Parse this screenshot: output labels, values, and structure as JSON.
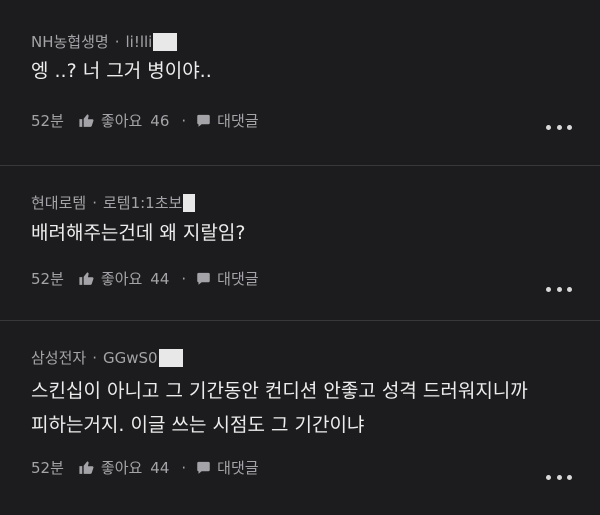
{
  "comments": [
    {
      "company": "NH농협생명",
      "username": "li!lli",
      "text": "엥 ..? 너 그거 병이야..",
      "time": "52분",
      "likes_label": "좋아요",
      "likes": "46",
      "reply_label": "대댓글"
    },
    {
      "company": "현대로템",
      "username": "로템1:1초보",
      "text": "배려해주는건데 왜 지랄임?",
      "time": "52분",
      "likes_label": "좋아요",
      "likes": "44",
      "reply_label": "대댓글"
    },
    {
      "company": "삼성전자",
      "username": "GGwS0",
      "text_line1": "스킨십이 아니고 그 기간동안 컨디션 안좋고 성격 드러워지니까",
      "text_line2": "피하는거지. 이글 쓰는 시점도 그 기간이냐",
      "time": "52분",
      "likes_label": "좋아요",
      "likes": "44",
      "reply_label": "대댓글"
    }
  ],
  "separator": "·",
  "icons": [
    "thumbs-up-icon",
    "speech-bubble-icon",
    "more-options-icon"
  ],
  "colors": {
    "background": "#1c1c1e",
    "meta_text": "#a4a4a8",
    "body_text": "#ececec",
    "divider": "#38383b"
  }
}
